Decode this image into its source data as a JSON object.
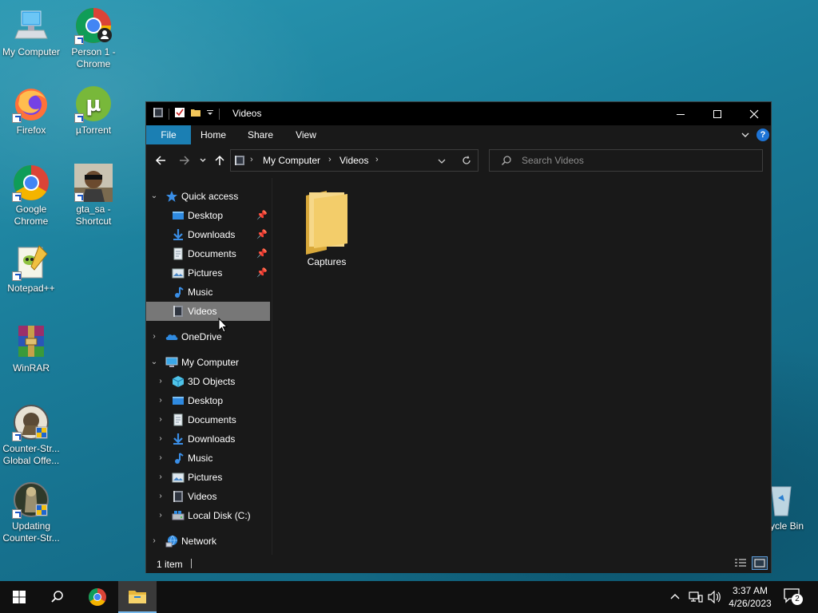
{
  "desktop": {
    "icons": [
      {
        "label": "My Computer",
        "icon": "computer-icon"
      },
      {
        "label": "Person 1 - Chrome",
        "icon": "chrome-icon"
      },
      {
        "label": "Firefox",
        "icon": "firefox-icon"
      },
      {
        "label": "µTorrent",
        "icon": "utorrent-icon"
      },
      {
        "label": "Google Chrome",
        "icon": "chrome-icon"
      },
      {
        "label": "gta_sa - Shortcut",
        "icon": "gta-icon"
      },
      {
        "label": "Notepad++",
        "icon": "notepadpp-icon"
      },
      {
        "label": "WinRAR",
        "icon": "winrar-icon"
      },
      {
        "label": "Counter-Str... Global Offe...",
        "icon": "csgo-icon"
      },
      {
        "label": "Updating Counter-Str...",
        "icon": "csgo-update-icon"
      },
      {
        "label": "ycle Bin",
        "icon": "recycle-bin-icon"
      }
    ]
  },
  "window": {
    "title": "Videos",
    "ribbon_tabs": [
      "File",
      "Home",
      "Share",
      "View"
    ],
    "address": {
      "segments": [
        "My Computer",
        "Videos"
      ]
    },
    "search": {
      "placeholder": "Search Videos"
    },
    "nav": {
      "quick_access": "Quick access",
      "quick_items": [
        "Desktop",
        "Downloads",
        "Documents",
        "Pictures",
        "Music",
        "Videos"
      ],
      "onedrive": "OneDrive",
      "my_computer": "My Computer",
      "computer_items": [
        "3D Objects",
        "Desktop",
        "Documents",
        "Downloads",
        "Music",
        "Pictures",
        "Videos",
        "Local Disk (C:)"
      ],
      "network": "Network",
      "selected": "Videos"
    },
    "content": {
      "items": [
        {
          "name": "Captures",
          "icon": "folder-icon"
        }
      ]
    },
    "status": {
      "item_count": "1 item"
    }
  },
  "taskbar": {
    "time": "3:37 AM",
    "date": "4/26/2023",
    "notification_count": "2"
  },
  "colors": {
    "accent": "#1b7fb3",
    "window_bg": "#191919",
    "titlebar": "#000000",
    "selected": "#777777",
    "taskbar": "#101010"
  }
}
